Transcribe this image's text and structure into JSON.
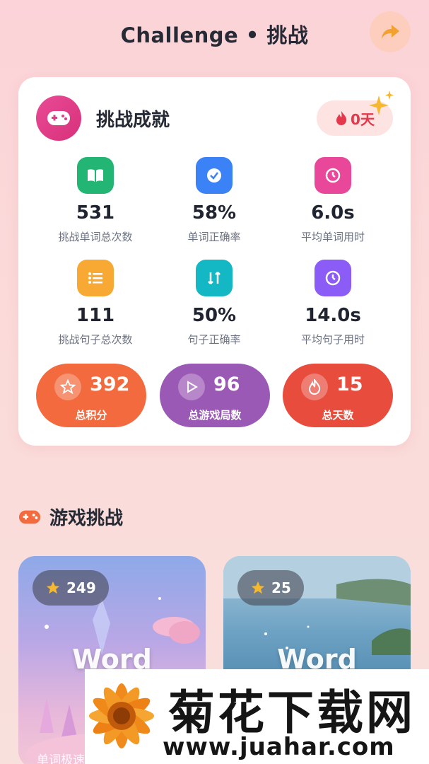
{
  "header": {
    "title": "Challenge • 挑战",
    "share_icon": "share-arrow-icon",
    "accent": "#f2a02e"
  },
  "achievement_card": {
    "title": "挑战成就",
    "icon": "gamepad-icon",
    "streak": "0天",
    "stats": [
      {
        "value": "531",
        "label": "挑战单词总次数",
        "icon": "book-icon",
        "color": "#22b573"
      },
      {
        "value": "58%",
        "label": "单词正确率",
        "icon": "check-circle-icon",
        "color": "#3b82f6"
      },
      {
        "value": "6.0s",
        "label": "平均单词用时",
        "icon": "timer-icon",
        "color": "#e8479a"
      },
      {
        "value": "111",
        "label": "挑战句子总次数",
        "icon": "list-icon",
        "color": "#f7a934"
      },
      {
        "value": "50%",
        "label": "句子正确率",
        "icon": "swap-icon",
        "color": "#14b8c4"
      },
      {
        "value": "14.0s",
        "label": "平均句子用时",
        "icon": "timer-icon",
        "color": "#8b5cf6"
      }
    ],
    "summary": [
      {
        "value": "392",
        "label": "总积分",
        "icon": "star-icon",
        "color": "#f26a3d"
      },
      {
        "value": "96",
        "label": "总游戏局数",
        "icon": "play-icon",
        "color": "#9b59b6"
      },
      {
        "value": "15",
        "label": "总天数",
        "icon": "flame-icon",
        "color": "#e84c3d"
      }
    ]
  },
  "games_section": {
    "title": "游戏挑战",
    "icon": "gamepad-icon",
    "games": [
      {
        "rating": "249",
        "title": "Word",
        "subtitle": "单词极速"
      },
      {
        "rating": "25",
        "title": "Word",
        "subtitle": ""
      }
    ]
  },
  "watermark": {
    "title": "菊花下载网",
    "url": "www.juahar.com"
  }
}
